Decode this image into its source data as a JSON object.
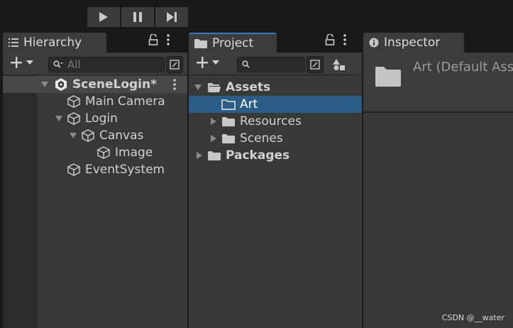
{
  "toolbar": {
    "play_icon": "play-icon",
    "pause_icon": "pause-icon",
    "step_icon": "step-icon"
  },
  "hierarchy": {
    "tab_label": "Hierarchy",
    "search_placeholder": "All",
    "items": [
      {
        "label": "SceneLogin*",
        "icon": "unity-scene-icon",
        "expanded": true
      },
      {
        "label": "Main Camera",
        "icon": "gameobject-icon"
      },
      {
        "label": "Login",
        "icon": "gameobject-icon",
        "expanded": true
      },
      {
        "label": "Canvas",
        "icon": "gameobject-icon",
        "expanded": true
      },
      {
        "label": "Image",
        "icon": "gameobject-icon"
      },
      {
        "label": "EventSystem",
        "icon": "gameobject-icon"
      }
    ]
  },
  "project": {
    "tab_label": "Project",
    "items": [
      {
        "label": "Assets",
        "icon": "folder-open-icon",
        "expanded": true
      },
      {
        "label": "Art",
        "icon": "folder-outline-icon",
        "selected": true
      },
      {
        "label": "Resources",
        "icon": "folder-icon",
        "expanded": false
      },
      {
        "label": "Scenes",
        "icon": "folder-icon",
        "expanded": false
      },
      {
        "label": "Packages",
        "icon": "folder-icon",
        "expanded": false
      }
    ]
  },
  "inspector": {
    "tab_label": "Inspector",
    "title": "Art (Default Asset)",
    "icon": "folder-icon"
  },
  "watermark": "CSDN @__water",
  "colors": {
    "selection": "#2c5d87",
    "tab_accent": "#3a79bb",
    "panel_bg": "#383838"
  }
}
